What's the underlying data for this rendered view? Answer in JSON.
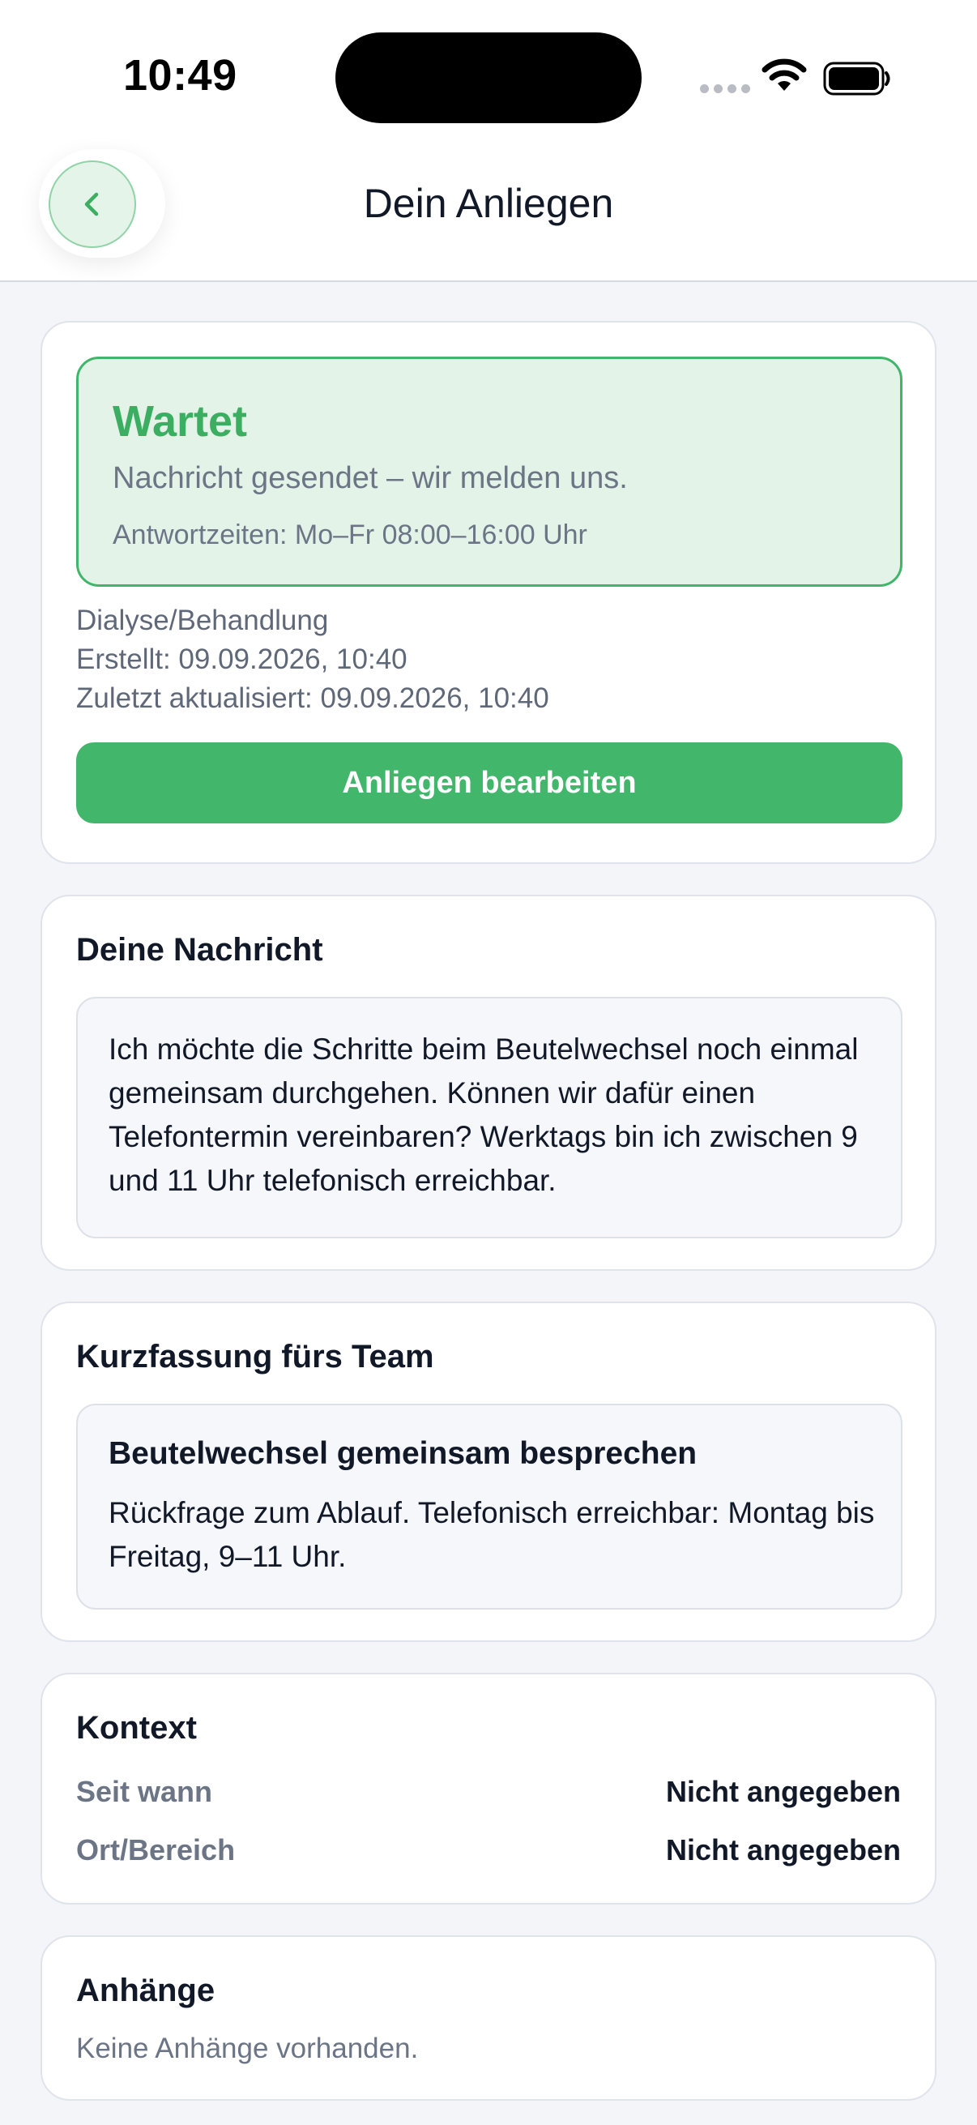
{
  "status_bar": {
    "time": "10:49"
  },
  "header": {
    "title": "Dein Anliegen",
    "back_icon": "chevron-left-icon"
  },
  "status_card": {
    "status": "Wartet",
    "message": "Nachricht gesendet – wir melden uns.",
    "hours": "Antwortzeiten: Mo–Fr 08:00–16:00 Uhr",
    "category": "Dialyse/Behandlung",
    "created": "Erstellt: 09.09.2026, 10:40",
    "updated": "Zuletzt aktualisiert: 09.09.2026, 10:40",
    "edit_button": "Anliegen bearbeiten"
  },
  "message_card": {
    "title": "Deine Nachricht",
    "text": "Ich möchte die Schritte beim Beutelwechsel noch einmal gemeinsam durchgehen. Können wir dafür einen Telefontermin vereinbaren? Werktags bin ich zwischen 9 und 11 Uhr telefonisch erreichbar."
  },
  "summary_card": {
    "title": "Kurzfassung fürs Team",
    "heading": "Beutelwechsel gemeinsam besprechen",
    "text": "Rückfrage zum Ablauf. Telefonisch erreichbar: Montag bis Freitag, 9–11 Uhr."
  },
  "context_card": {
    "title": "Kontext",
    "rows": [
      {
        "label": "Seit wann",
        "value": "Nicht angegeben"
      },
      {
        "label": "Ort/Bereich",
        "value": "Nicht angegeben"
      }
    ]
  },
  "attachments_card": {
    "title": "Anhänge",
    "empty": "Keine Anhänge vorhanden."
  },
  "colors": {
    "accent": "#42b66b",
    "status_bg": "#e4f3e8",
    "muted_text": "#6b7586",
    "page_bg": "#f3f5f9"
  }
}
